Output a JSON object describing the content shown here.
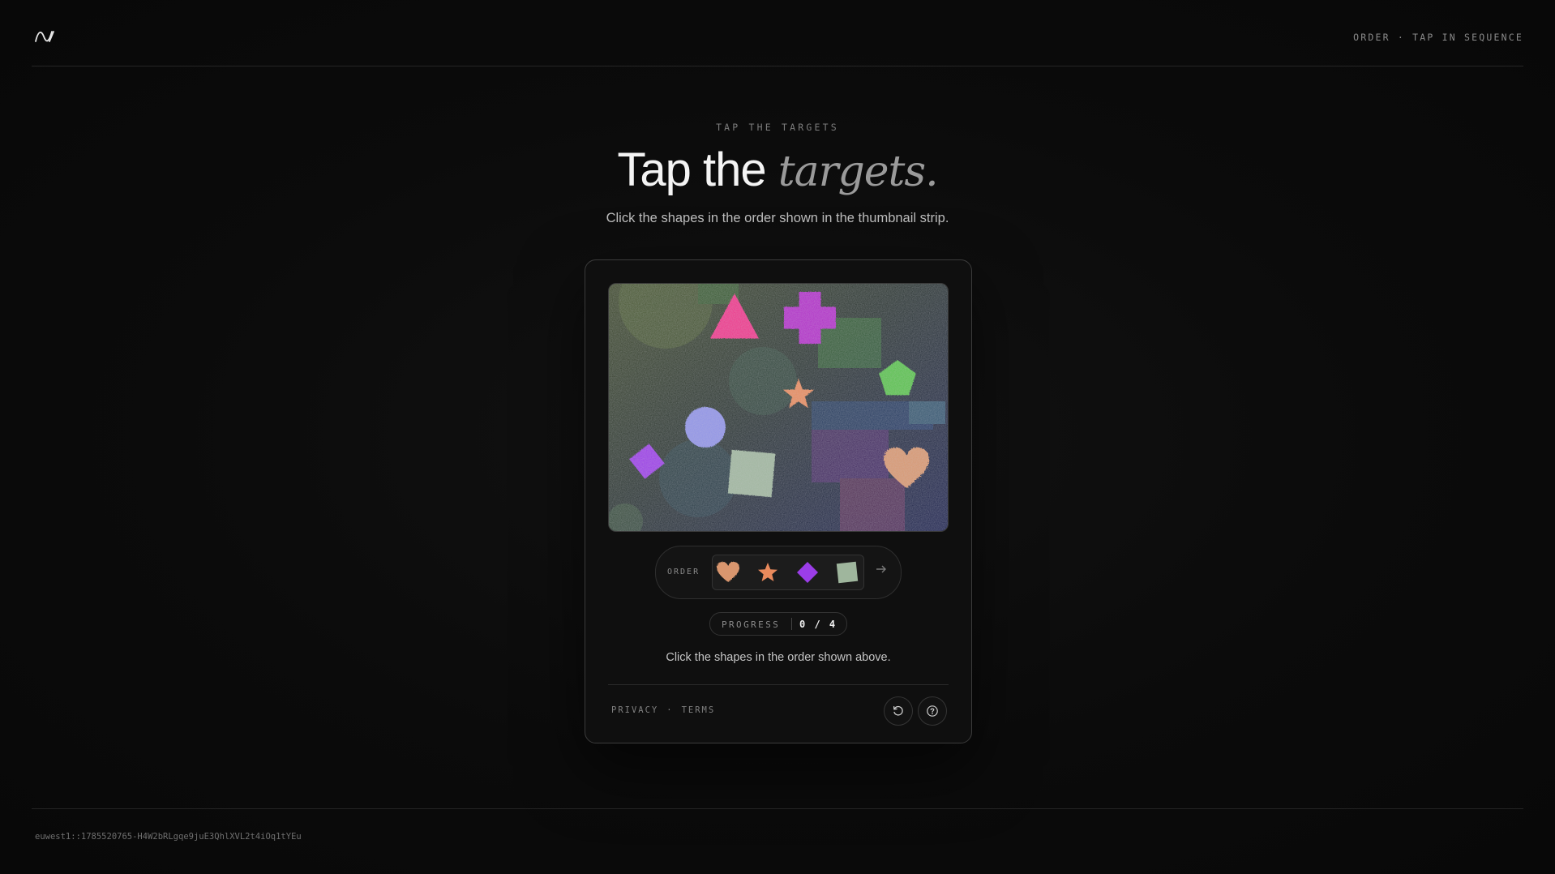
{
  "header": {
    "mode_label": "ORDER · TAP IN SEQUENCE"
  },
  "hero": {
    "eyebrow": "TAP THE TARGETS",
    "title_main": "Tap the",
    "title_accent": "targets.",
    "subtitle": "Click the shapes in the order shown in the thumbnail strip."
  },
  "challenge": {
    "targets": [
      {
        "shape": "triangle",
        "color": "#f0368a"
      },
      {
        "shape": "cross",
        "color": "#b22ec9"
      },
      {
        "shape": "pentagon",
        "color": "#58c24c"
      },
      {
        "shape": "star",
        "color": "#e98a5c"
      },
      {
        "shape": "circle",
        "color": "#8f92e8"
      },
      {
        "shape": "diamond",
        "color": "#9b3de8"
      },
      {
        "shape": "square",
        "color": "#9fb69d"
      },
      {
        "shape": "heart",
        "color": "#d9966e"
      }
    ]
  },
  "order": {
    "label": "ORDER",
    "sequence": [
      "heart",
      "star",
      "diamond",
      "square"
    ],
    "next_icon": "arrow-right-icon"
  },
  "progress": {
    "label": "PROGRESS",
    "value": "0 / 4",
    "current": 0,
    "total": 4
  },
  "hint": "Click the shapes in the order shown above.",
  "footer": {
    "privacy": "PRIVACY",
    "separator": "·",
    "terms": "TERMS",
    "reload_icon": "reload-icon",
    "help_icon": "help-icon"
  },
  "session_id": "euwest1::1785520765-H4W2bRLgqe9juE3QhlXVL2t4iOq1tYEu"
}
